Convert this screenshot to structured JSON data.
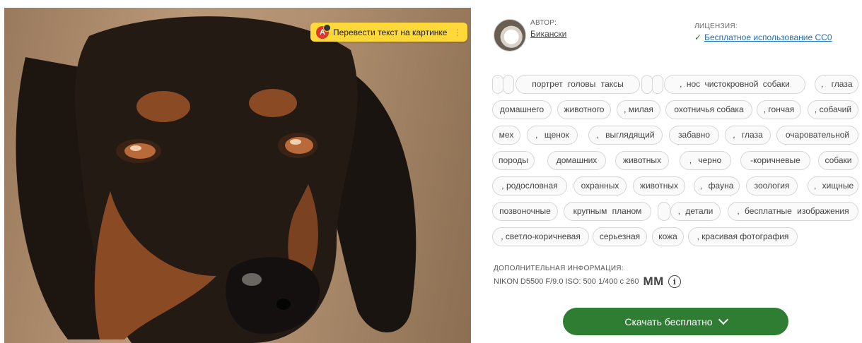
{
  "photo": {
    "alt_icon": "dachshund-dog-photo",
    "translate_button": {
      "label": "Перевести текст на картинке",
      "more_icon": "⋮"
    }
  },
  "author": {
    "label": "Автор:",
    "name": "Бикански"
  },
  "license": {
    "label": "Лицензия:",
    "check": "✓",
    "name": "Бесплатное использование CC0"
  },
  "tags": [
    [
      "",
      "",
      "портрет головы таксы",
      "",
      "",
      ", нос чистокровной собаки",
      ", глаза"
    ],
    [
      "домашнего",
      "животного",
      ", милая",
      "охотничья собака",
      ", гончая",
      ", собачий"
    ],
    [
      "мех",
      ", щенок",
      ", выглядящий",
      "забавно",
      ", глаза",
      "очаровательной"
    ],
    [
      "породы",
      "домашних",
      "животных",
      ", черно",
      "-коричневые",
      "собаки"
    ],
    [
      ", родословная",
      "охранных",
      "животных",
      ", фауна",
      "зоология",
      ", хищные"
    ],
    [
      "позвоночные",
      "крупным планом",
      "",
      ", детали",
      ", бесплатные изображения"
    ],
    [
      ", светло-коричневая",
      "серьезная",
      "кожа",
      ", красивая фотография"
    ]
  ],
  "extra_info": {
    "title": "Дополнительная информация:",
    "exif": "NIKON D5500 F/9.0 ISO: 500 1/400 с 260",
    "unit": "ММ",
    "info_icon": "i"
  },
  "download": {
    "label": "Скачать бесплатно"
  },
  "colors": {
    "accent": "#2e7d32",
    "link": "#1a6fb5",
    "translate_bg": "#ffd83a"
  }
}
